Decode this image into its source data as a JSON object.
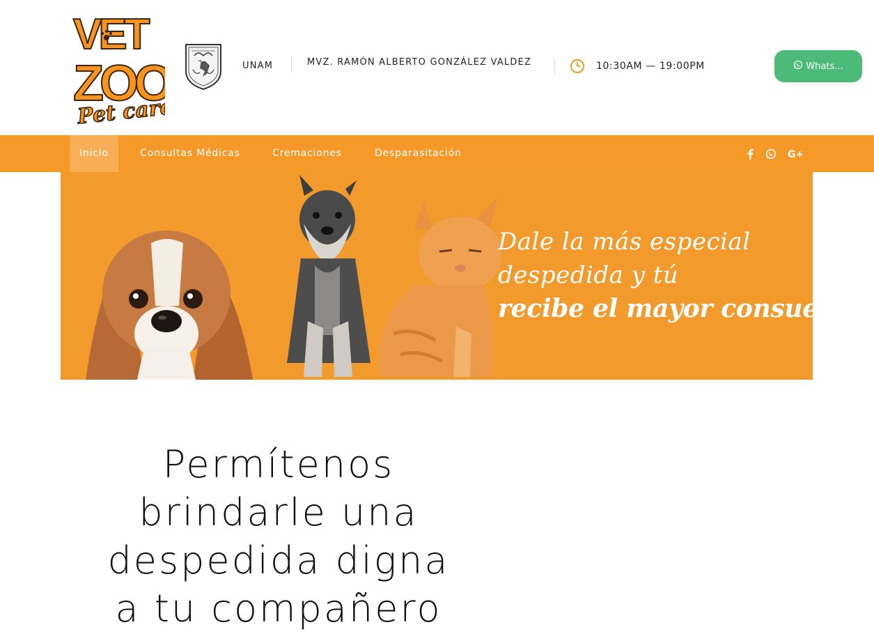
{
  "header": {
    "logo": {
      "name": "vet-zoo-pet-care-logo",
      "text_top": "VET",
      "text_mid": "ZOO",
      "text_script": "Pet care"
    },
    "unam_label": "UNAM",
    "doctor_name": "MVZ. RAMÓN ALBERTO GONZÁLEZ VALDEZ",
    "hours_icon": "clock-icon",
    "hours": "10:30AM — 19:00PM",
    "whatsapp_button": {
      "icon": "whatsapp-icon",
      "label": "Whats..."
    }
  },
  "nav": {
    "items": [
      {
        "label": "Inicio",
        "active": true
      },
      {
        "label": "Consultas Médicas",
        "active": false
      },
      {
        "label": "Cremaciones",
        "active": false
      },
      {
        "label": "Desparasitación",
        "active": false
      }
    ],
    "social": [
      "facebook-icon",
      "whatsapp-icon",
      "google-plus-icon"
    ]
  },
  "banner": {
    "line1": "Dale la más especial",
    "line2": "despedida y tú",
    "line3": "recibe el mayor consuelo..."
  },
  "headline": {
    "lines": [
      "Permítenos",
      "brindarle una",
      "despedida digna",
      "a tu compañero"
    ]
  },
  "colors": {
    "brand_orange": "#f59a28",
    "nav_active": "#f7ae54",
    "banner_bg": "#f39a2d",
    "whatsapp_green": "#4cbb79",
    "clock_orange": "#f0a023"
  }
}
